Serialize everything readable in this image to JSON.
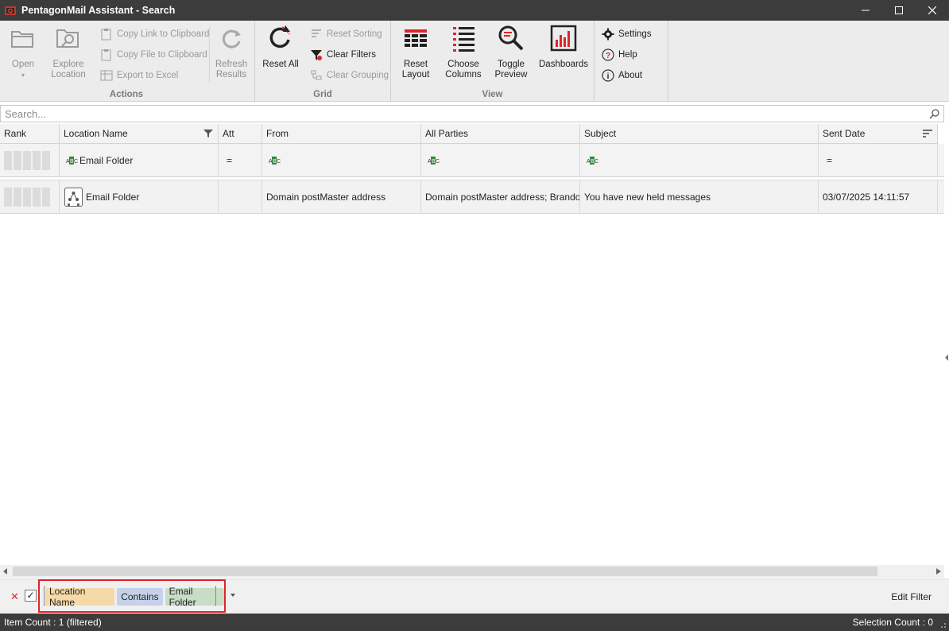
{
  "window": {
    "title": "PentagonMail Assistant - Search",
    "minimize": "minimize",
    "maximize": "maximize",
    "close": "close"
  },
  "ribbon": {
    "actions": {
      "label": "Actions",
      "open": "Open",
      "explore_location_1": "Explore",
      "explore_location_2": "Location",
      "copy_link": "Copy Link to Clipboard",
      "copy_file": "Copy File to Clipboard",
      "export_excel": "Export to Excel",
      "refresh_1": "Refresh",
      "refresh_2": "Results"
    },
    "grid": {
      "label": "Grid",
      "reset_all": "Reset All",
      "reset_sorting": "Reset Sorting",
      "clear_filters": "Clear Filters",
      "clear_grouping": "Clear Grouping"
    },
    "view": {
      "label": "View",
      "reset_layout_1": "Reset",
      "reset_layout_2": "Layout",
      "choose_columns_1": "Choose",
      "choose_columns_2": "Columns",
      "toggle_preview_1": "Toggle",
      "toggle_preview_2": "Preview",
      "dashboards": "Dashboards"
    },
    "misc": {
      "settings": "Settings",
      "help": "Help",
      "about": "About"
    }
  },
  "search": {
    "placeholder": "Search..."
  },
  "grid": {
    "columns": [
      "Rank",
      "Location Name",
      "Att",
      "From",
      "All Parties",
      "Subject",
      "Sent Date"
    ],
    "filter_row": {
      "location_name": "Email Folder",
      "att": "=",
      "sent_date": "="
    },
    "rows": [
      {
        "location_name": "Email Folder",
        "att": "",
        "from": "Domain postMaster address",
        "all_parties": "Domain postMaster address; Brando...",
        "subject": "You have new held messages",
        "sent_date": "03/07/2025 14:11:57"
      }
    ]
  },
  "filter_panel": {
    "field": "Location Name",
    "operator": "Contains",
    "value": "Email Folder",
    "edit_filter": "Edit Filter"
  },
  "status": {
    "item_count": "Item Count : 1 (filtered)",
    "selection_count": "Selection Count : 0"
  },
  "colors": {
    "titlebar": "#3c3c3c",
    "accent_red": "#e0242a",
    "chip_field": "#f5d9a8",
    "chip_operator": "#c6d2ea",
    "chip_value": "#c8dcc6"
  }
}
